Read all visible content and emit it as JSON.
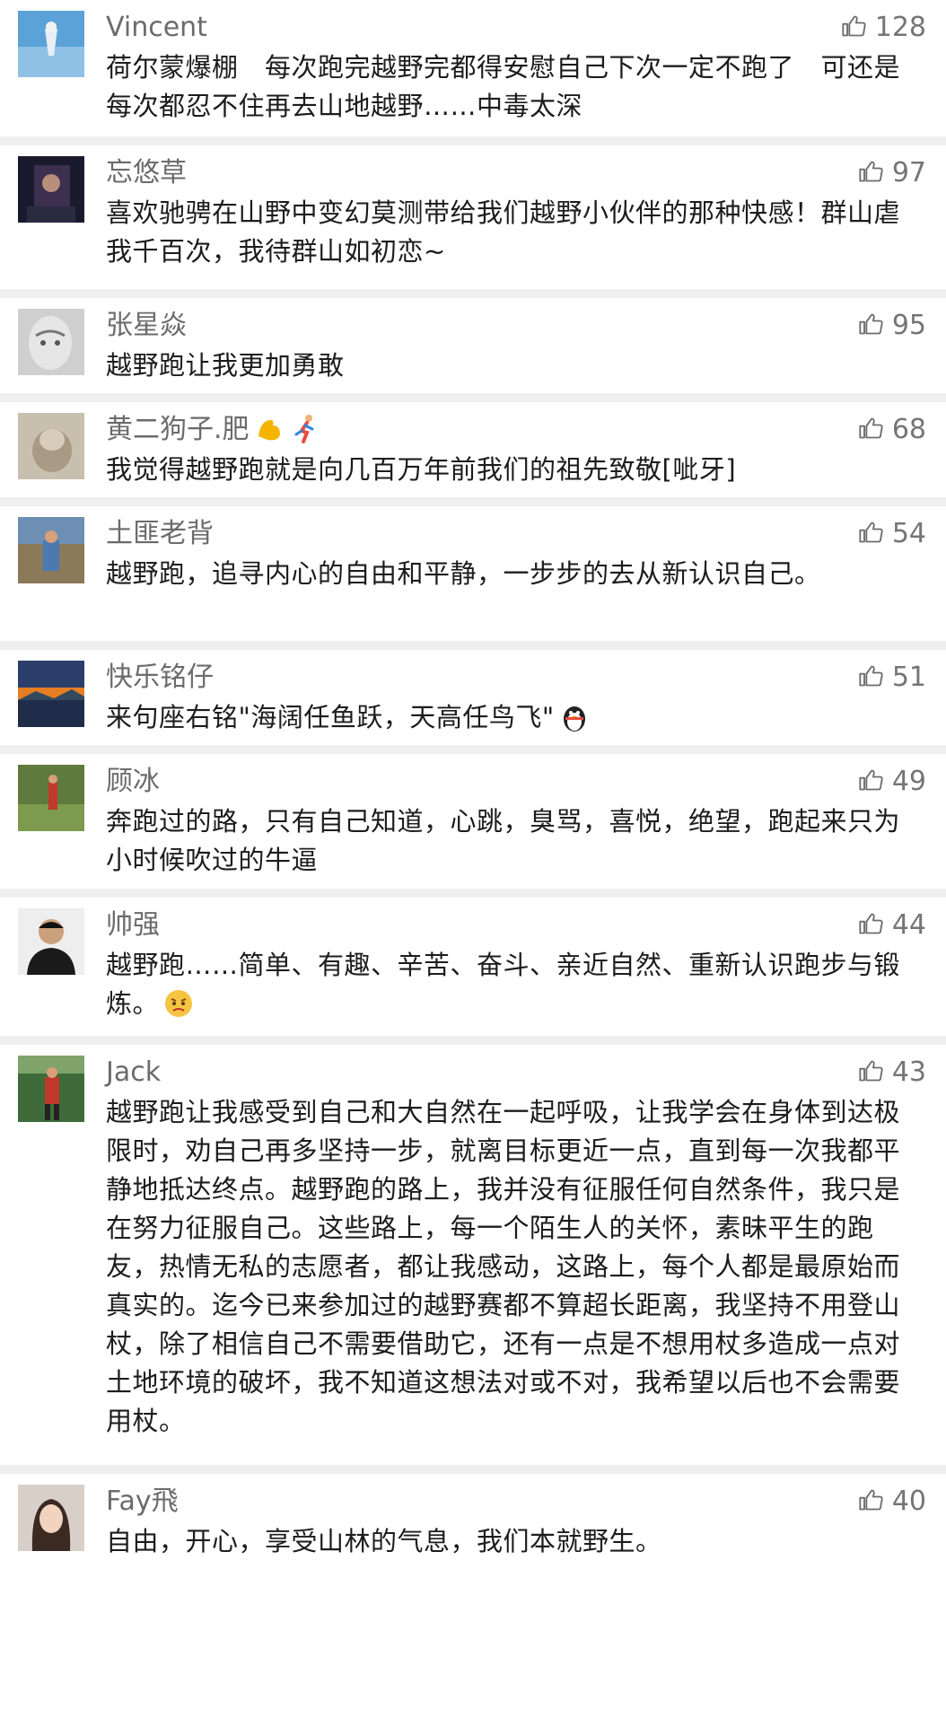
{
  "comments": [
    {
      "name": "Vincent",
      "likes": "128",
      "text": "荷尔蒙爆棚　每次跑完越野完都得安慰自己下次一定不跑了　可还是每次都忍不住再去山地越野……中毒太深"
    },
    {
      "name": "忘悠草",
      "likes": "97",
      "text": "喜欢驰骋在山野中变幻莫测带给我们越野小伙伴的那种快感！群山虐我千百次，我待群山如初恋~"
    },
    {
      "name": "张星焱",
      "likes": "95",
      "text": "越野跑让我更加勇敢"
    },
    {
      "name": "黄二狗子.肥",
      "likes": "68",
      "text": "我觉得越野跑就是向几百万年前我们的祖先致敬[呲牙]"
    },
    {
      "name": "土匪老背",
      "likes": "54",
      "text": "越野跑，追寻内心的自由和平静，一步步的去从新认识自己。"
    },
    {
      "name": "快乐铭仔",
      "likes": "51",
      "text": "来句座右铭\"海阔任鱼跃，天高任鸟飞\""
    },
    {
      "name": "顾冰",
      "likes": "49",
      "text": "奔跑过的路，只有自己知道，心跳，臭骂，喜悦，绝望，跑起来只为小时候吹过的牛逼"
    },
    {
      "name": "帅强",
      "likes": "44",
      "text": "越野跑……简单、有趣、辛苦、奋斗、亲近自然、重新认识跑步与锻炼。"
    },
    {
      "name": "Jack",
      "likes": "43",
      "text": "越野跑让我感受到自己和大自然在一起呼吸，让我学会在身体到达极限时，劝自己再多坚持一步，就离目标更近一点，直到每一次我都平静地抵达终点。越野跑的路上，我并没有征服任何自然条件，我只是在努力征服自己。这些路上，每一个陌生人的关怀，素昧平生的跑友，热情无私的志愿者，都让我感动，这路上，每个人都是最原始而真实的。迄今已来参加过的越野赛都不算超长距离，我坚持不用登山杖，除了相信自己不需要借助它，还有一点是不想用杖多造成一点对土地环境的破坏，我不知道这想法对或不对，我希望以后也不会需要用杖。"
    },
    {
      "name": "Fay飛",
      "likes": "40",
      "text": "自由，开心，享受山林的气息，我们本就野生。"
    }
  ],
  "colors": {
    "name": "#6b6b6b",
    "text": "#1c1c1c",
    "divider": "#efefef",
    "likes": "#757575"
  },
  "icons": {
    "like": "thumbs-up-icon",
    "emoji_flex": "flexed-biceps-emoji",
    "emoji_runner": "runner-emoji",
    "emoji_penguin": "penguin-emoji",
    "emoji_face": "thinking-face-emoji"
  }
}
